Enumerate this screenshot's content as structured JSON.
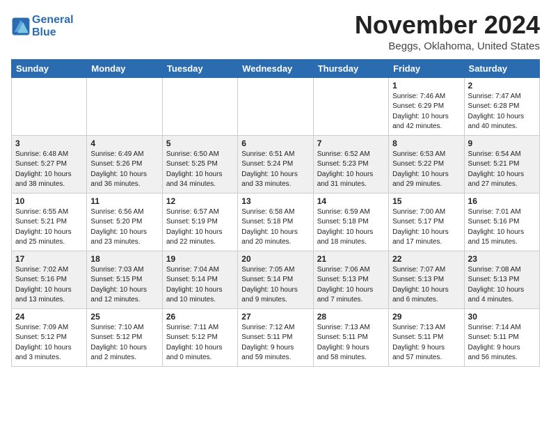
{
  "header": {
    "logo_line1": "General",
    "logo_line2": "Blue",
    "month": "November 2024",
    "location": "Beggs, Oklahoma, United States"
  },
  "days_of_week": [
    "Sunday",
    "Monday",
    "Tuesday",
    "Wednesday",
    "Thursday",
    "Friday",
    "Saturday"
  ],
  "weeks": [
    [
      {
        "day": "",
        "info": ""
      },
      {
        "day": "",
        "info": ""
      },
      {
        "day": "",
        "info": ""
      },
      {
        "day": "",
        "info": ""
      },
      {
        "day": "",
        "info": ""
      },
      {
        "day": "1",
        "info": "Sunrise: 7:46 AM\nSunset: 6:29 PM\nDaylight: 10 hours\nand 42 minutes."
      },
      {
        "day": "2",
        "info": "Sunrise: 7:47 AM\nSunset: 6:28 PM\nDaylight: 10 hours\nand 40 minutes."
      }
    ],
    [
      {
        "day": "3",
        "info": "Sunrise: 6:48 AM\nSunset: 5:27 PM\nDaylight: 10 hours\nand 38 minutes."
      },
      {
        "day": "4",
        "info": "Sunrise: 6:49 AM\nSunset: 5:26 PM\nDaylight: 10 hours\nand 36 minutes."
      },
      {
        "day": "5",
        "info": "Sunrise: 6:50 AM\nSunset: 5:25 PM\nDaylight: 10 hours\nand 34 minutes."
      },
      {
        "day": "6",
        "info": "Sunrise: 6:51 AM\nSunset: 5:24 PM\nDaylight: 10 hours\nand 33 minutes."
      },
      {
        "day": "7",
        "info": "Sunrise: 6:52 AM\nSunset: 5:23 PM\nDaylight: 10 hours\nand 31 minutes."
      },
      {
        "day": "8",
        "info": "Sunrise: 6:53 AM\nSunset: 5:22 PM\nDaylight: 10 hours\nand 29 minutes."
      },
      {
        "day": "9",
        "info": "Sunrise: 6:54 AM\nSunset: 5:21 PM\nDaylight: 10 hours\nand 27 minutes."
      }
    ],
    [
      {
        "day": "10",
        "info": "Sunrise: 6:55 AM\nSunset: 5:21 PM\nDaylight: 10 hours\nand 25 minutes."
      },
      {
        "day": "11",
        "info": "Sunrise: 6:56 AM\nSunset: 5:20 PM\nDaylight: 10 hours\nand 23 minutes."
      },
      {
        "day": "12",
        "info": "Sunrise: 6:57 AM\nSunset: 5:19 PM\nDaylight: 10 hours\nand 22 minutes."
      },
      {
        "day": "13",
        "info": "Sunrise: 6:58 AM\nSunset: 5:18 PM\nDaylight: 10 hours\nand 20 minutes."
      },
      {
        "day": "14",
        "info": "Sunrise: 6:59 AM\nSunset: 5:18 PM\nDaylight: 10 hours\nand 18 minutes."
      },
      {
        "day": "15",
        "info": "Sunrise: 7:00 AM\nSunset: 5:17 PM\nDaylight: 10 hours\nand 17 minutes."
      },
      {
        "day": "16",
        "info": "Sunrise: 7:01 AM\nSunset: 5:16 PM\nDaylight: 10 hours\nand 15 minutes."
      }
    ],
    [
      {
        "day": "17",
        "info": "Sunrise: 7:02 AM\nSunset: 5:16 PM\nDaylight: 10 hours\nand 13 minutes."
      },
      {
        "day": "18",
        "info": "Sunrise: 7:03 AM\nSunset: 5:15 PM\nDaylight: 10 hours\nand 12 minutes."
      },
      {
        "day": "19",
        "info": "Sunrise: 7:04 AM\nSunset: 5:14 PM\nDaylight: 10 hours\nand 10 minutes."
      },
      {
        "day": "20",
        "info": "Sunrise: 7:05 AM\nSunset: 5:14 PM\nDaylight: 10 hours\nand 9 minutes."
      },
      {
        "day": "21",
        "info": "Sunrise: 7:06 AM\nSunset: 5:13 PM\nDaylight: 10 hours\nand 7 minutes."
      },
      {
        "day": "22",
        "info": "Sunrise: 7:07 AM\nSunset: 5:13 PM\nDaylight: 10 hours\nand 6 minutes."
      },
      {
        "day": "23",
        "info": "Sunrise: 7:08 AM\nSunset: 5:13 PM\nDaylight: 10 hours\nand 4 minutes."
      }
    ],
    [
      {
        "day": "24",
        "info": "Sunrise: 7:09 AM\nSunset: 5:12 PM\nDaylight: 10 hours\nand 3 minutes."
      },
      {
        "day": "25",
        "info": "Sunrise: 7:10 AM\nSunset: 5:12 PM\nDaylight: 10 hours\nand 2 minutes."
      },
      {
        "day": "26",
        "info": "Sunrise: 7:11 AM\nSunset: 5:12 PM\nDaylight: 10 hours\nand 0 minutes."
      },
      {
        "day": "27",
        "info": "Sunrise: 7:12 AM\nSunset: 5:11 PM\nDaylight: 9 hours\nand 59 minutes."
      },
      {
        "day": "28",
        "info": "Sunrise: 7:13 AM\nSunset: 5:11 PM\nDaylight: 9 hours\nand 58 minutes."
      },
      {
        "day": "29",
        "info": "Sunrise: 7:13 AM\nSunset: 5:11 PM\nDaylight: 9 hours\nand 57 minutes."
      },
      {
        "day": "30",
        "info": "Sunrise: 7:14 AM\nSunset: 5:11 PM\nDaylight: 9 hours\nand 56 minutes."
      }
    ]
  ]
}
